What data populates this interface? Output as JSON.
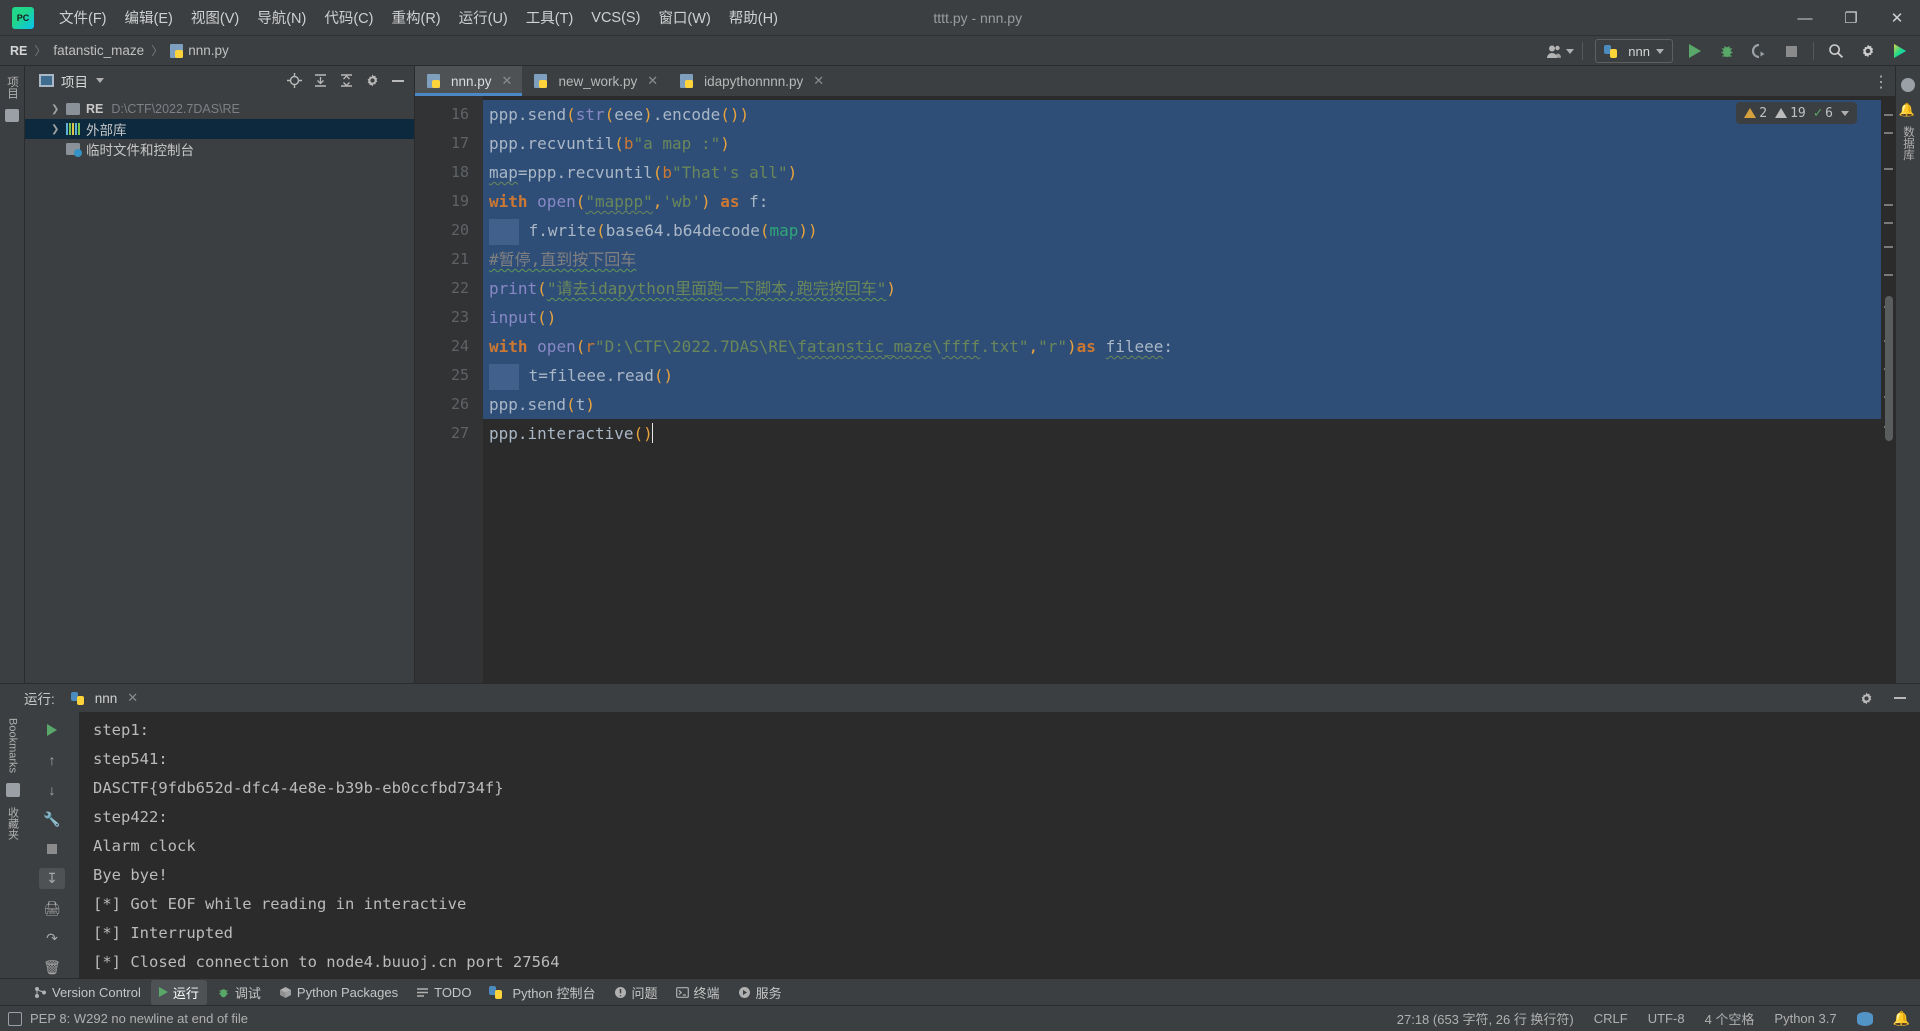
{
  "window": {
    "title": "tttt.py - nnn.py",
    "minimize": "—",
    "maximize": "❐",
    "close": "✕",
    "logo": "PC"
  },
  "menubar": {
    "items": [
      {
        "label": "文件(F)",
        "name": "menu-file"
      },
      {
        "label": "编辑(E)",
        "name": "menu-edit"
      },
      {
        "label": "视图(V)",
        "name": "menu-view"
      },
      {
        "label": "导航(N)",
        "name": "menu-navigate"
      },
      {
        "label": "代码(C)",
        "name": "menu-code"
      },
      {
        "label": "重构(R)",
        "name": "menu-refactor"
      },
      {
        "label": "运行(U)",
        "name": "menu-run"
      },
      {
        "label": "工具(T)",
        "name": "menu-tools"
      },
      {
        "label": "VCS(S)",
        "name": "menu-vcs"
      },
      {
        "label": "窗口(W)",
        "name": "menu-window"
      },
      {
        "label": "帮助(H)",
        "name": "menu-help"
      }
    ]
  },
  "navbar": {
    "breadcrumb": [
      {
        "label": "RE",
        "type": "module"
      },
      {
        "label": "fatanstic_maze",
        "type": "folder"
      },
      {
        "label": "nnn.py",
        "type": "pyfile"
      }
    ],
    "separator": "〉",
    "run_config": "nnn",
    "icons": {
      "account": "account-icon",
      "run": "run-icon",
      "debug": "debug-icon",
      "coverage": "run-with-coverage-icon",
      "stop": "stop-icon",
      "search": "search-icon",
      "settings": "settings-icon",
      "updates": "updates-icon"
    }
  },
  "left_strip": {
    "items": [
      {
        "label": "项目",
        "name": "tool-project"
      },
      {
        "label": "",
        "name": "tool-structure"
      }
    ]
  },
  "project_pane": {
    "title": "项目",
    "header_icons": [
      "locate-icon",
      "expand-all-icon",
      "collapse-all-icon",
      "settings-icon",
      "hide-icon"
    ],
    "tree": [
      {
        "label": "RE",
        "hint": "D:\\CTF\\2022.7DAS\\RE",
        "icon": "folder-icon",
        "expandable": true,
        "selected": false,
        "bold": true
      },
      {
        "label": "外部库",
        "hint": "",
        "icon": "library-icon",
        "expandable": true,
        "selected": true,
        "bold": false
      },
      {
        "label": "临时文件和控制台",
        "hint": "",
        "icon": "scratches-icon",
        "expandable": false,
        "selected": false,
        "bold": false
      }
    ]
  },
  "editor": {
    "tabs": [
      {
        "label": "nnn.py",
        "active": true
      },
      {
        "label": "new_work.py",
        "active": false
      },
      {
        "label": "idapythonnnn.py",
        "active": false
      }
    ],
    "tab_close": "✕",
    "more_tabs": "⋮",
    "inspections": {
      "errors_count": "2",
      "warnings_count": "19",
      "ok_count": "6",
      "chevron": "⌄"
    },
    "first_line_number": 16,
    "lines": [
      {
        "n": 16,
        "selected": true,
        "text": "ppp.send(str(eee).encode())"
      },
      {
        "n": 17,
        "selected": true,
        "text": "ppp.recvuntil(b\"a map :\")"
      },
      {
        "n": 18,
        "selected": true,
        "text": "map=ppp.recvuntil(b\"That's all\")"
      },
      {
        "n": 19,
        "selected": true,
        "text": "with open(\"mappp\",'wb') as f:"
      },
      {
        "n": 20,
        "selected": true,
        "text": "    f.write(base64.b64decode(map))"
      },
      {
        "n": 21,
        "selected": true,
        "text": "#暂停,直到按下回车"
      },
      {
        "n": 22,
        "selected": true,
        "text": "print(\"请去idapython里面跑一下脚本,跑完按回车\")"
      },
      {
        "n": 23,
        "selected": true,
        "text": "input()"
      },
      {
        "n": 24,
        "selected": true,
        "text": "with open(r\"D:\\CTF\\2022.7DAS\\RE\\fatanstic_maze\\ffff.txt\",\"r\")as fileee:"
      },
      {
        "n": 25,
        "selected": true,
        "text": "    t=fileee.read()"
      },
      {
        "n": 26,
        "selected": true,
        "text": "ppp.send(t)"
      },
      {
        "n": 27,
        "selected": false,
        "text": "ppp.interactive()"
      }
    ]
  },
  "right_strip": {
    "items": [
      {
        "label": "",
        "name": "github-copilot-icon"
      },
      {
        "label": "",
        "name": "notifications-icon"
      },
      {
        "label": "数据库",
        "name": "tool-database"
      }
    ]
  },
  "run_window": {
    "label": "运行:",
    "tab_label": "nnn",
    "close": "✕",
    "settings_icon": "settings-icon",
    "hide_icon": "hide-icon",
    "side_icons": [
      "rerun-icon",
      "up-stack-icon",
      "down-stack-icon",
      "wrench-icon",
      "stop-icon",
      "scroll-to-end-icon",
      "print-icon",
      "soft-wrap-icon",
      "clear-all-icon"
    ],
    "console_lines": [
      "step1:",
      "step541:",
      "DASCTF{9fdb652d-dfc4-4e8e-b39b-eb0ccfbd734f}",
      "step422:",
      "Alarm clock",
      "Bye bye!",
      "[*] Got EOF while reading in interactive",
      "[*] Interrupted",
      "[*] Closed connection to node4.buuoj.cn port 27564"
    ]
  },
  "bottom_bar": {
    "items": [
      {
        "label": "Version Control",
        "icon": "branch-icon",
        "active": false
      },
      {
        "label": "运行",
        "icon": "run-icon",
        "active": true
      },
      {
        "label": "调试",
        "icon": "debug-icon",
        "active": false
      },
      {
        "label": "Python Packages",
        "icon": "packages-icon",
        "active": false
      },
      {
        "label": "TODO",
        "icon": "todo-icon",
        "active": false
      },
      {
        "label": "Python 控制台",
        "icon": "python-console-icon",
        "active": false
      },
      {
        "label": "问题",
        "icon": "problems-icon",
        "active": false
      },
      {
        "label": "终端",
        "icon": "terminal-icon",
        "active": false
      },
      {
        "label": "服务",
        "icon": "services-icon",
        "active": false
      }
    ]
  },
  "status_bar": {
    "message": "PEP 8: W292 no newline at end of file",
    "position": "27:18 (653 字符, 26 行 换行符)",
    "line_separator": "CRLF",
    "encoding": "UTF-8",
    "indent": "4 个空格",
    "interpreter": "Python 3.7",
    "db_icon": "database-icon",
    "bell_icon": "notifications-icon"
  },
  "bookmarks_strip": {
    "label": "Bookmarks",
    "secondary": "收藏夹"
  }
}
